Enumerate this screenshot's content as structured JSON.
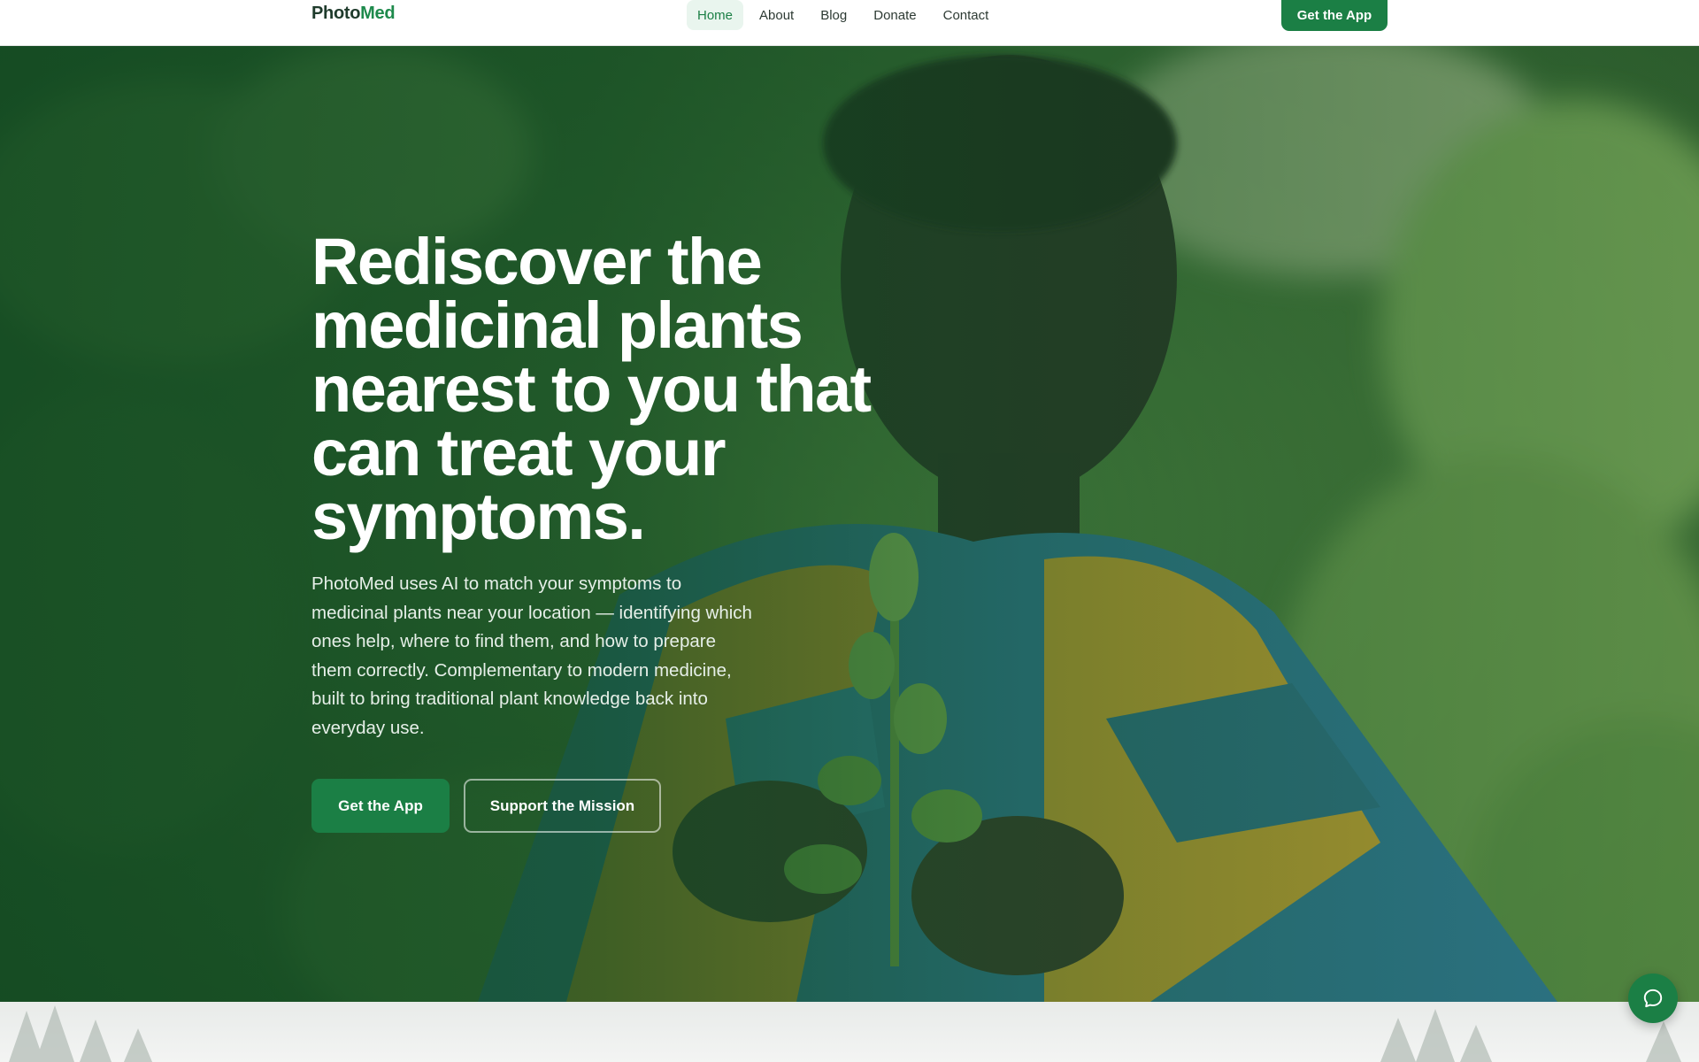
{
  "brand": {
    "name_part1": "Photo",
    "name_part2": "Med"
  },
  "nav": {
    "links": [
      {
        "label": "Home",
        "active": true
      },
      {
        "label": "About",
        "active": false
      },
      {
        "label": "Blog",
        "active": false
      },
      {
        "label": "Donate",
        "active": false
      },
      {
        "label": "Contact",
        "active": false
      }
    ],
    "cta_label": "Get the App"
  },
  "hero": {
    "title": "Rediscover the medicinal plants nearest to you that can treat your symptoms.",
    "description": "PhotoMed uses AI to match your symptoms to medicinal plants near your location — identifying which ones help, where to find them, and how to prepare them correctly. Complementary to modern medicine, built to bring traditional plant knowledge back into everyday use.",
    "primary_button": "Get the App",
    "secondary_button": "Support the Mission"
  },
  "icons": {
    "chat": "chat-bubble-icon"
  },
  "colors": {
    "brand_green": "#1b7f45",
    "brand_dark": "#1f3b2c",
    "nav_active_bg": "#e9f5ee"
  }
}
